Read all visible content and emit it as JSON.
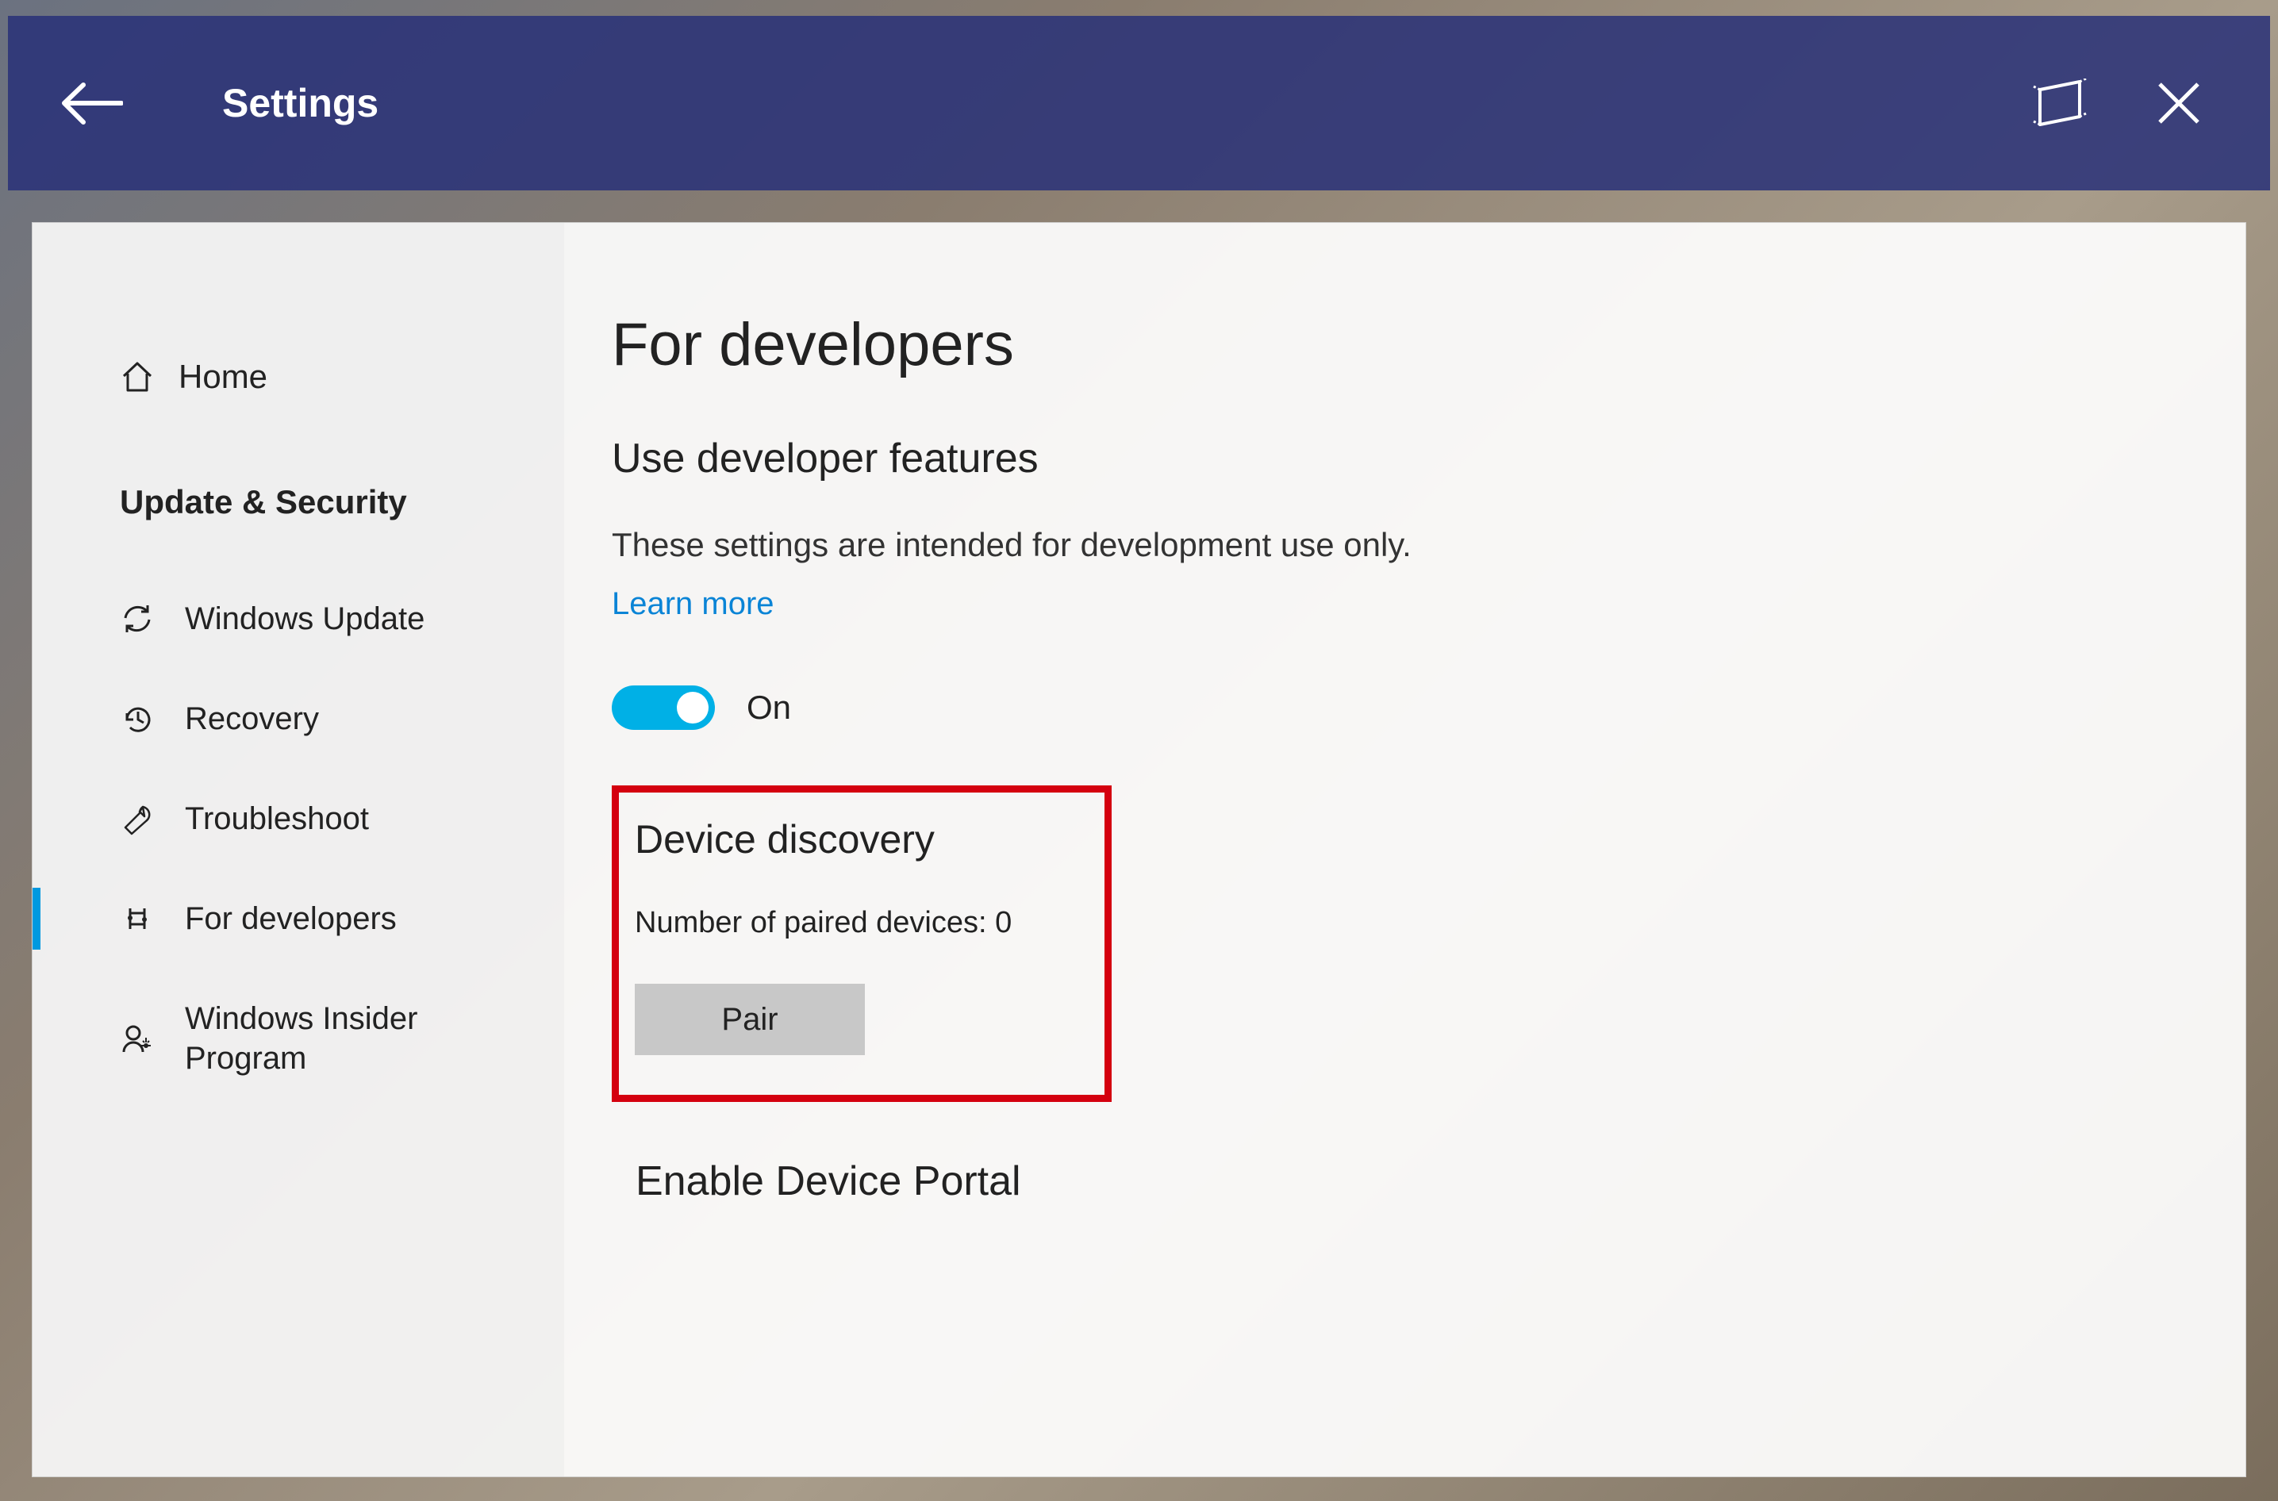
{
  "titlebar": {
    "title": "Settings"
  },
  "sidebar": {
    "home": "Home",
    "section": "Update & Security",
    "items": [
      {
        "icon": "sync-icon",
        "label": "Windows Update"
      },
      {
        "icon": "history-icon",
        "label": "Recovery"
      },
      {
        "icon": "wrench-icon",
        "label": "Troubleshoot"
      },
      {
        "icon": "dev-icon",
        "label": "For developers",
        "selected": true
      },
      {
        "icon": "insider-icon",
        "label": "Windows Insider Program"
      }
    ]
  },
  "content": {
    "page_title": "For developers",
    "subheading": "Use developer features",
    "description": "These settings are intended for development use only.",
    "learn_more": "Learn more",
    "toggle_state": "On",
    "device_discovery": {
      "heading": "Device discovery",
      "paired_label": "Number of paired devices: 0",
      "pair_button": "Pair"
    },
    "portal_heading": "Enable Device Portal"
  }
}
